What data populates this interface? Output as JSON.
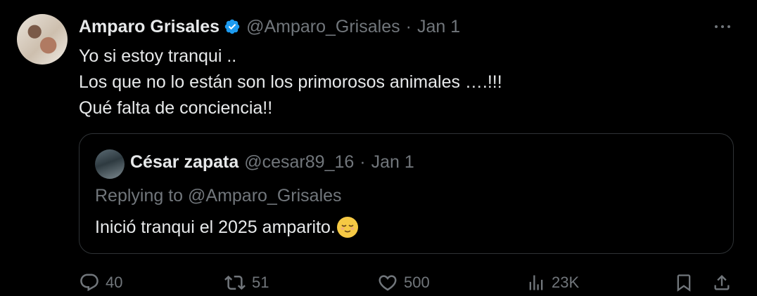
{
  "tweet": {
    "author_name": "Amparo Grisales",
    "author_handle": "@Amparo_Grisales",
    "separator": "·",
    "date": "Jan 1",
    "text_lines": [
      "Yo si estoy tranqui ..",
      "Los que no lo están son los primorosos animales ….!!!",
      "Qué falta de conciencia!!"
    ]
  },
  "quote": {
    "author_name": "César zapata",
    "author_handle": "@cesar89_16",
    "separator": "·",
    "date": "Jan 1",
    "replying_to": "Replying to @Amparo_Grisales",
    "text": "Inició tranqui el 2025 amparito.",
    "emoji_icon": "relieved-face-icon"
  },
  "actions": {
    "replies": "40",
    "reposts": "51",
    "likes": "500",
    "views": "23K"
  },
  "colors": {
    "background": "#000000",
    "text_primary": "#e7e9ea",
    "text_secondary": "#71767b",
    "verified": "#1d9bf0",
    "border": "#2f3336"
  }
}
